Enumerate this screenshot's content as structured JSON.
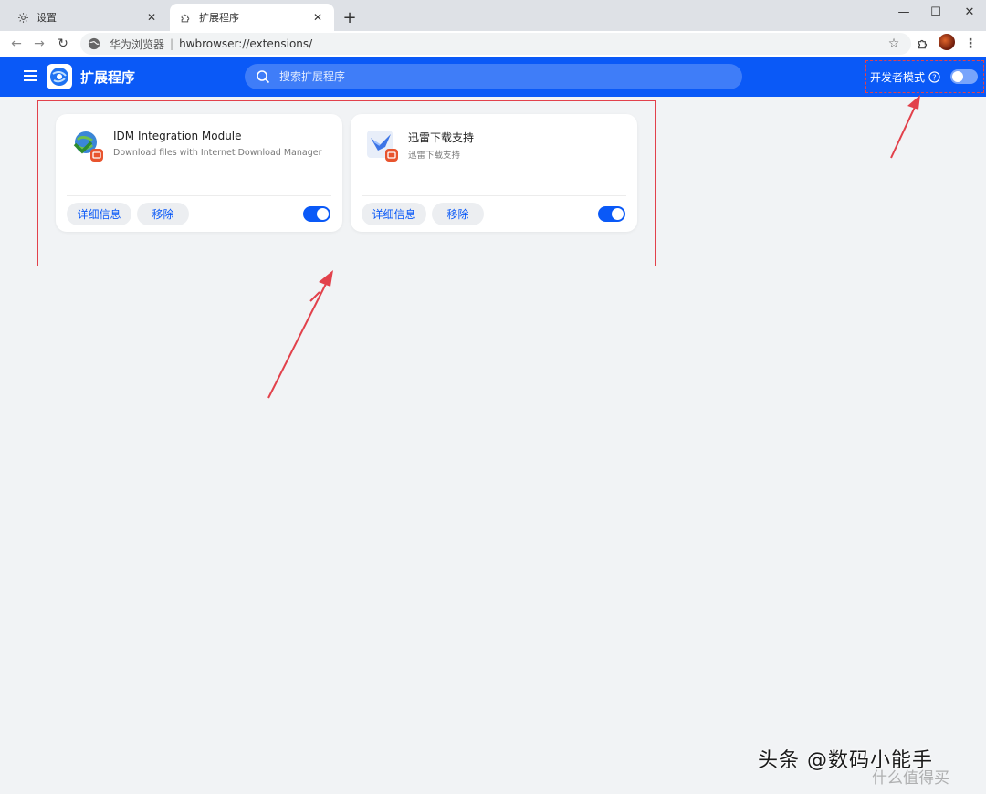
{
  "browser": {
    "tabs": [
      {
        "title": "设置",
        "icon": "gear-icon",
        "active": false
      },
      {
        "title": "扩展程序",
        "icon": "puzzle-icon",
        "active": true
      }
    ],
    "address": {
      "site_name": "华为浏览器",
      "separator": "|",
      "url": "hwbrowser://extensions/"
    }
  },
  "header": {
    "title": "扩展程序",
    "search_placeholder": "搜索扩展程序",
    "dev_mode_label": "开发者模式",
    "dev_mode_on": false
  },
  "extensions": [
    {
      "name": "IDM Integration Module",
      "description": "Download files with Internet Download Manager",
      "details_label": "详细信息",
      "remove_label": "移除",
      "enabled": true
    },
    {
      "name": "迅雷下载支持",
      "description": "迅雷下载支持",
      "details_label": "详细信息",
      "remove_label": "移除",
      "enabled": true
    }
  ],
  "watermark": {
    "text": "头条 @数码小能手",
    "subtext": "什么值得买"
  },
  "colors": {
    "accent": "#0a59f7",
    "annotation": "#e2414b",
    "background": "#f1f3f5"
  }
}
